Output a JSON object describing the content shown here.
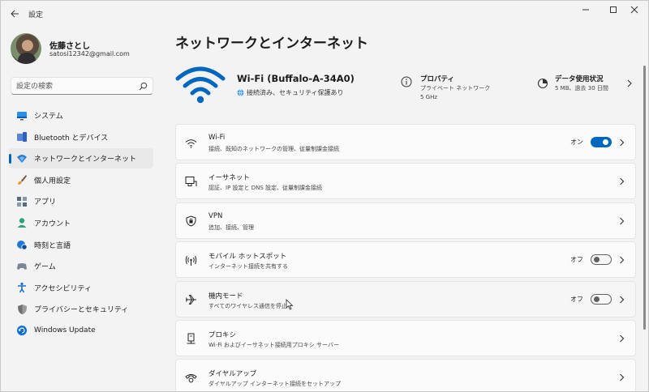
{
  "app": {
    "title": "設定"
  },
  "profile": {
    "name": "佐藤さとし",
    "email": "satosi12342@gmail.com"
  },
  "search": {
    "placeholder": "設定の検索"
  },
  "nav": {
    "items": [
      {
        "label": "システム",
        "icon": "monitor-icon",
        "color": "#0078d4"
      },
      {
        "label": "Bluetooth とデバイス",
        "icon": "bluetooth-devices-icon",
        "color": "#3d6ed6"
      },
      {
        "label": "ネットワークとインターネット",
        "icon": "network-icon",
        "color": "#2a7fd4",
        "selected": true
      },
      {
        "label": "個人用設定",
        "icon": "brush-icon",
        "color": "#e8a33b"
      },
      {
        "label": "アプリ",
        "icon": "apps-icon",
        "color": "#5a6c7a"
      },
      {
        "label": "アカウント",
        "icon": "account-icon",
        "color": "#2ea37a"
      },
      {
        "label": "時刻と言語",
        "icon": "globe-clock-icon",
        "color": "#1f7ad6"
      },
      {
        "label": "ゲーム",
        "icon": "gamepad-icon",
        "color": "#6b7280"
      },
      {
        "label": "アクセシビリティ",
        "icon": "accessibility-icon",
        "color": "#1f6fc4"
      },
      {
        "label": "プライバシーとセキュリティ",
        "icon": "shield-icon",
        "color": "#6e6e6e"
      },
      {
        "label": "Windows Update",
        "icon": "update-icon",
        "color": "#0a6ccf"
      }
    ]
  },
  "page": {
    "title": "ネットワークとインターネット"
  },
  "hero": {
    "ssid": "Wi-Fi (Buffalo-A-34A0)",
    "status": "接続済み、セキュリティ保護あり",
    "properties_title": "プロパティ",
    "properties_line1": "プライベート ネットワーク",
    "properties_line2": "5 GHz",
    "data_title": "データ使用状況",
    "data_sub": "5 MB、過去 30 日間",
    "accent": "#0067c0"
  },
  "cards": [
    {
      "title": "Wi-Fi",
      "subtitle": "接続、既知のネットワークの管理、従量制課金接続",
      "icon": "wifi-icon",
      "toggle": "オン",
      "toggle_on": true
    },
    {
      "title": "イーサネット",
      "subtitle": "認証、IP 設定と DNS 設定、従量制課金接続",
      "icon": "ethernet-icon"
    },
    {
      "title": "VPN",
      "subtitle": "追加、接続、管理",
      "icon": "vpn-shield-icon"
    },
    {
      "title": "モバイル ホットスポット",
      "subtitle": "インターネット接続を共有する",
      "icon": "hotspot-icon",
      "toggle": "オフ",
      "toggle_on": false
    },
    {
      "title": "機内モード",
      "subtitle": "すべてのワイヤレス通信を停止",
      "icon": "airplane-icon",
      "toggle": "オフ",
      "toggle_on": false
    },
    {
      "title": "プロキシ",
      "subtitle": "Wi-Fi およびイーサネット接続用プロキシ サーバー",
      "icon": "proxy-icon"
    },
    {
      "title": "ダイヤルアップ",
      "subtitle": "ダイヤルアップ インターネット接続をセットアップ",
      "icon": "dialup-icon"
    }
  ]
}
